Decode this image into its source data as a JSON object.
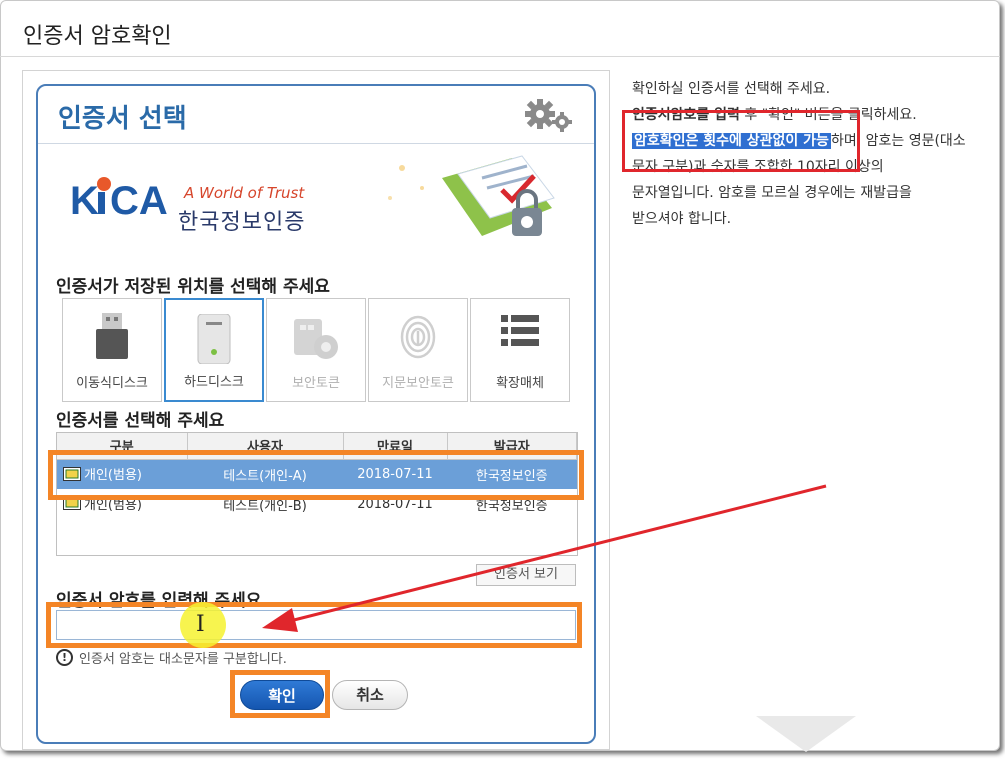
{
  "page": {
    "title": "인증서 암호확인"
  },
  "dialog": {
    "title": "인증서 선택",
    "brand": {
      "logo_text": "KICA",
      "tagline": "A World of Trust",
      "name": "한국정보인증"
    },
    "storage_section_label": "인증서가 저장된 위치를 선택해 주세요",
    "storage_options": [
      {
        "label": "이동식디스크",
        "icon": "usb-drive-icon",
        "state": "enabled"
      },
      {
        "label": "하드디스크",
        "icon": "hard-disk-icon",
        "state": "selected"
      },
      {
        "label": "보안토큰",
        "icon": "security-token-icon",
        "state": "disabled"
      },
      {
        "label": "지문보안토큰",
        "icon": "fingerprint-icon",
        "state": "disabled"
      },
      {
        "label": "확장매체",
        "icon": "list-icon",
        "state": "enabled"
      }
    ],
    "cert_section_label": "인증서를 선택해 주세요",
    "table": {
      "columns": [
        "구분",
        "사용자",
        "만료일",
        "발급자"
      ],
      "rows": [
        {
          "type": "개인(범용)",
          "user": "테스트(개인-A)",
          "expiry": "2018-07-11",
          "issuer": "한국정보인증",
          "selected": true
        },
        {
          "type": "개인(범용)",
          "user": "테스트(개인-B)",
          "expiry": "2018-07-11",
          "issuer": "한국정보인증",
          "selected": false
        }
      ]
    },
    "view_cert_button": "인증서 보기",
    "password_label": "인증서 암호를 입력해 주세요",
    "password_value": "",
    "password_note": "인증서 암호는 대소문자를 구분합니다.",
    "ok_button": "확인",
    "cancel_button": "취소"
  },
  "instructions": {
    "line1": "확인하실 인증서를 선택해 주세요.",
    "line2_bold": "인증서암호를 입력",
    "line2_rest": " 후 \"확인\" 버튼을 클릭하세요.",
    "line3_highlight": "암호확인은 횟수에 상관없이 가능",
    "line3_rest": "하며, 암호는 영문(대소문자 구분)과 숫자를 조합한 10자리 이상의",
    "line4": "문자열입니다. 암호를 모르실 경우에는 재발급을",
    "line5": "받으셔야 합니다."
  },
  "colors": {
    "accent_blue": "#2a6aa8",
    "highlight_orange": "#f48526",
    "highlight_red": "#e0262c",
    "selected_row": "#6b9fd8"
  }
}
